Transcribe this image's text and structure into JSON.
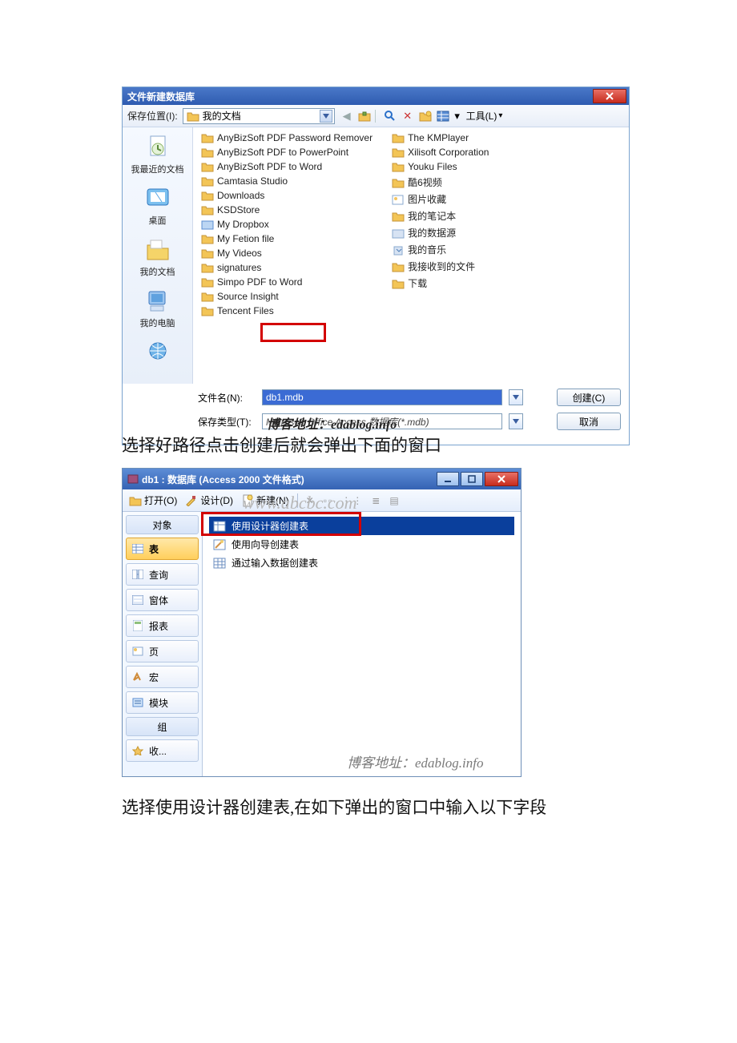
{
  "dialog1": {
    "title": "文件新建数据库",
    "save_in_label": "保存位置(I):",
    "location": "我的文档",
    "tools_label": "工具(L)",
    "places": [
      {
        "key": "recent",
        "label": "我最近的文档"
      },
      {
        "key": "desktop",
        "label": "桌面"
      },
      {
        "key": "mydocs",
        "label": "我的文档"
      },
      {
        "key": "mycomputer",
        "label": "我的电脑"
      },
      {
        "key": "network",
        "label": ""
      }
    ],
    "files_col1": [
      "AnyBizSoft PDF Password Remover",
      "AnyBizSoft PDF to PowerPoint",
      "AnyBizSoft PDF to Word",
      "Camtasia Studio",
      "Downloads",
      "KSDStore",
      "My Dropbox",
      "My Fetion file",
      "My Videos",
      "signatures",
      "Simpo PDF to Word",
      "Source Insight",
      "Tencent Files"
    ],
    "files_col2": [
      "The KMPlayer",
      "Xilisoft Corporation",
      "Youku Files",
      "酷6视频",
      "图片收藏",
      "我的笔记本",
      "我的数据源",
      "我的音乐",
      "我接收到的文件",
      "下载"
    ],
    "filename_label": "文件名(N):",
    "filename_value": "db1.mdb",
    "filetype_label": "保存类型(T):",
    "filetype_value": "Microsoft Office Access 数据库(*.mdb)",
    "filetype_overlay": "博客地址：edablog.info",
    "create_btn": "创建(C)",
    "cancel_btn": "取消"
  },
  "caption1": "选择好路径点击创建后就会弹出下面的窗口",
  "dialog2": {
    "title": "db1 : 数据库 (Access 2000 文件格式)",
    "toolbar": {
      "open": "打开(O)",
      "design": "设计(D)",
      "new": "新建(N)"
    },
    "watermark_top": "www.abcbc.com",
    "nav": {
      "objects": "对象",
      "table": "表",
      "query": "查询",
      "form": "窗体",
      "report": "报表",
      "page": "页",
      "macro": "宏",
      "module": "模块",
      "group": "组",
      "favorites": "收..."
    },
    "list": {
      "designer": "使用设计器创建表",
      "wizard": "使用向导创建表",
      "input": "通过输入数据创建表"
    },
    "watermark_bottom": "博客地址：edablog.info"
  },
  "caption2": "选择使用设计器创建表,在如下弹出的窗口中输入以下字段"
}
